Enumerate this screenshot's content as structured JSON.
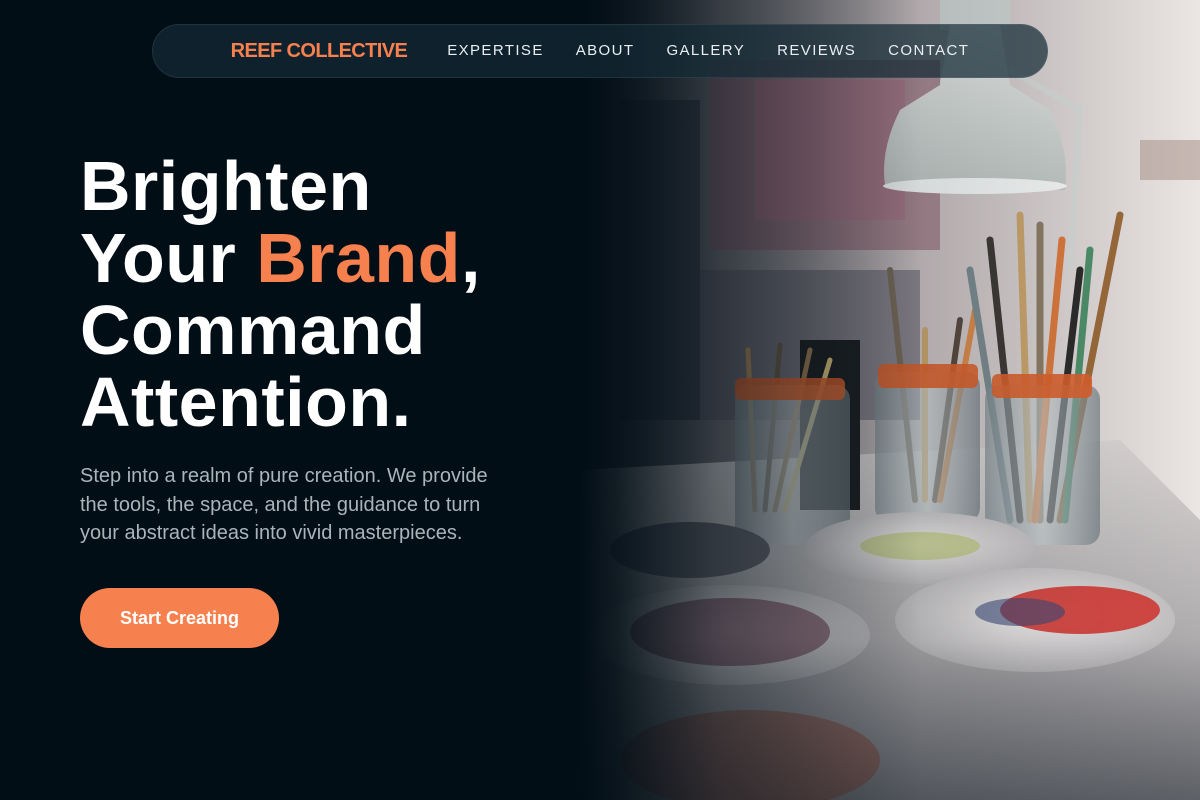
{
  "nav": {
    "brand": "REEF COLLECTIVE",
    "links": [
      "EXPERTISE",
      "ABOUT",
      "GALLERY",
      "REVIEWS",
      "CONTACT"
    ]
  },
  "hero": {
    "headline_line1": "Brighten",
    "headline_line2_pre": "Your ",
    "headline_line2_accent": "Brand",
    "headline_line2_post": ",",
    "headline_line3": "Command",
    "headline_line4": "Attention.",
    "subtext": "Step into a realm of pure creation. We provide the tools, the space, and the guidance to turn your abstract ideas into vivid masterpieces.",
    "cta_label": "Start Creating"
  },
  "colors": {
    "background": "#020e16",
    "accent": "#f7804f",
    "nav_background": "#142a34",
    "headline": "#ffffff",
    "subtext": "#a9b4bb"
  },
  "icons": {
    "hero_image": "art-studio-paintbrushes-photo"
  }
}
